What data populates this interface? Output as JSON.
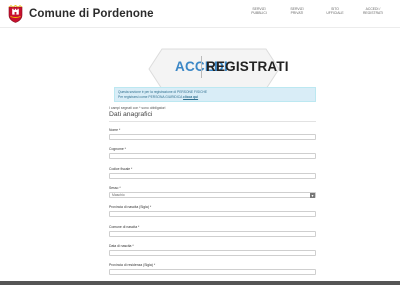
{
  "header": {
    "title": "Comune di Pordenone",
    "logo_icon": "coat-of-arms-icon",
    "nav": [
      {
        "line1": "SERVIZI",
        "line2": "PUBBLICI"
      },
      {
        "line1": "SERVIZI",
        "line2": "PRIVATI"
      },
      {
        "line1": "SITO",
        "line2": "UFFICIALE"
      },
      {
        "line1": "ACCEDI /",
        "line2": "REGISTRATI"
      }
    ]
  },
  "auth": {
    "login_label": "ACCEDI",
    "register_label": "REGISTRATI"
  },
  "notice": {
    "line1": "Questa sezione è per la registrazione di PERSONE FISICHE",
    "line2_prefix": "Per registrarsi come PERSONA GIURIDICA",
    "line2_link": "clicca qui"
  },
  "form": {
    "required_note": "I campi segnati con * sono obbligatori",
    "section_title": "Dati anagrafici",
    "fields": {
      "nome": {
        "label": "Nome *"
      },
      "cognome": {
        "label": "Cognome *"
      },
      "codice_fiscale": {
        "label": "Codice fiscale *"
      },
      "sesso": {
        "label": "Sesso *",
        "value": "Maschio"
      },
      "provincia_nascita": {
        "label": "Provincia di nascita (Sigla) *"
      },
      "comune_nascita": {
        "label": "Comune di nascita *"
      },
      "data_nascita": {
        "label": "Data di nascita *"
      },
      "provincia_residenza": {
        "label": "Provincia di residenza (Sigla) *"
      }
    }
  },
  "colors": {
    "accent": "#3b87c6",
    "notice_bg": "#d9edf7",
    "notice_text": "#31708f"
  }
}
